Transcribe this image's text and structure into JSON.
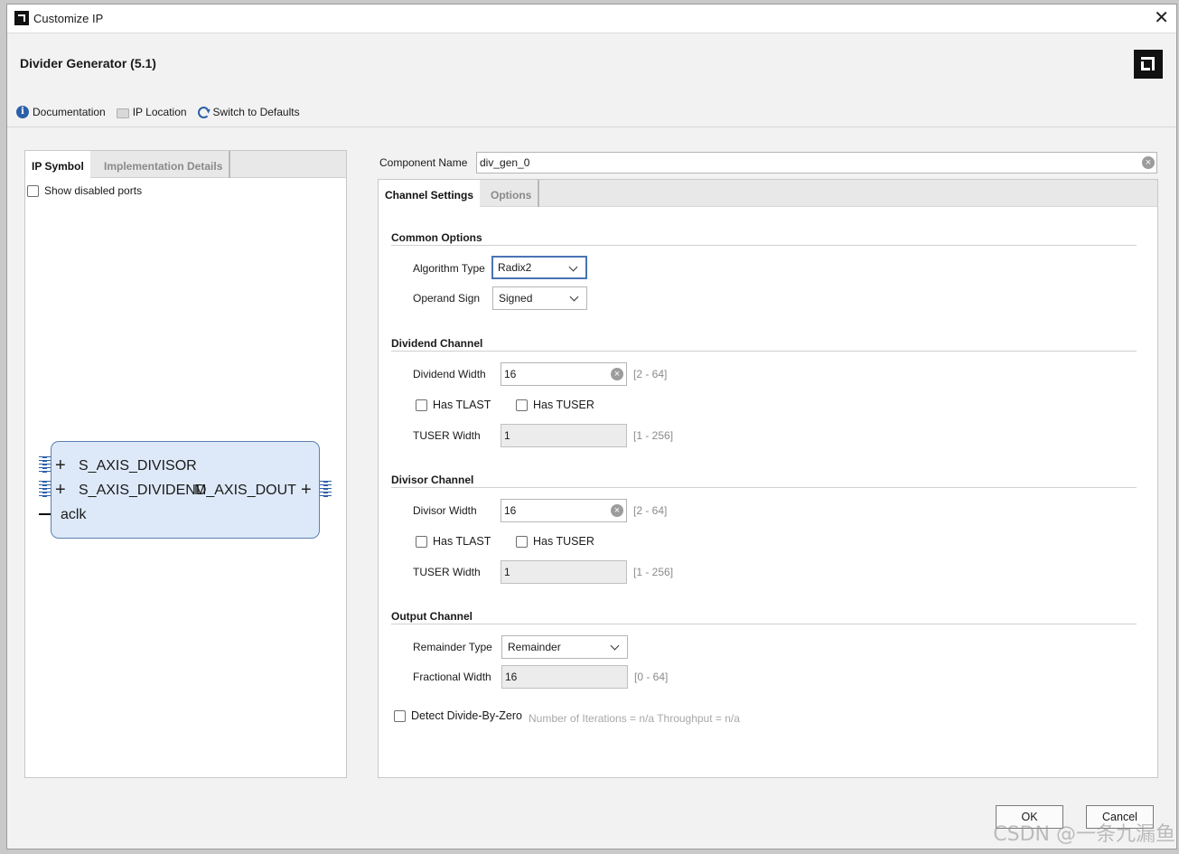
{
  "window": {
    "title": "Customize IP"
  },
  "header": {
    "title": "Divider Generator (5.1)",
    "toolbar": {
      "documentation": "Documentation",
      "ip_location": "IP Location",
      "switch_defaults": "Switch to Defaults"
    }
  },
  "left_panel": {
    "tabs": [
      "IP Symbol",
      "Implementation Details"
    ],
    "show_disabled_ports": "Show disabled ports",
    "symbol": {
      "ports_in": [
        "S_AXIS_DIVISOR",
        "S_AXIS_DIVIDEND",
        "aclk"
      ],
      "ports_out": [
        "M_AXIS_DOUT"
      ]
    }
  },
  "component": {
    "label": "Component Name",
    "value": "div_gen_0"
  },
  "right_panel": {
    "tabs": [
      "Channel Settings",
      "Options"
    ],
    "common": {
      "heading": "Common Options",
      "algorithm_label": "Algorithm Type",
      "algorithm_value": "Radix2",
      "operand_label": "Operand Sign",
      "operand_value": "Signed"
    },
    "dividend": {
      "heading": "Dividend Channel",
      "width_label": "Dividend Width",
      "width_value": "16",
      "width_range": "[2 - 64]",
      "tlast": "Has TLAST",
      "tuser": "Has TUSER",
      "tuser_width_label": "TUSER Width",
      "tuser_width_value": "1",
      "tuser_width_range": "[1 - 256]"
    },
    "divisor": {
      "heading": "Divisor Channel",
      "width_label": "Divisor Width",
      "width_value": "16",
      "width_range": "[2 - 64]",
      "tlast": "Has TLAST",
      "tuser": "Has TUSER",
      "tuser_width_label": "TUSER Width",
      "tuser_width_value": "1",
      "tuser_width_range": "[1 - 256]"
    },
    "output": {
      "heading": "Output Channel",
      "remainder_label": "Remainder Type",
      "remainder_value": "Remainder",
      "fractional_label": "Fractional Width",
      "fractional_value": "16",
      "fractional_range": "[0 - 64]"
    },
    "detect_divide_by_zero": "Detect Divide-By-Zero",
    "iterations_hint": "Number of Iterations = n/a  Throughput = n/a"
  },
  "buttons": {
    "ok": "OK",
    "cancel": "Cancel"
  },
  "watermark": "CSDN @一条九漏鱼"
}
